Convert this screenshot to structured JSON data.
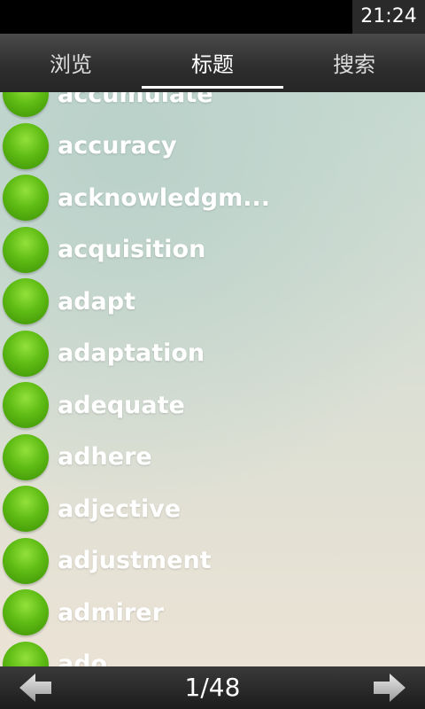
{
  "status": {
    "time": "21:24"
  },
  "tabs": [
    {
      "label": "浏览"
    },
    {
      "label": "标题"
    },
    {
      "label": "搜索"
    }
  ],
  "list": {
    "items": [
      {
        "label": "accumulate"
      },
      {
        "label": "accuracy"
      },
      {
        "label": "acknowledgm..."
      },
      {
        "label": "acquisition"
      },
      {
        "label": "adapt"
      },
      {
        "label": "adaptation"
      },
      {
        "label": "adequate"
      },
      {
        "label": "adhere"
      },
      {
        "label": "adjective"
      },
      {
        "label": "adjustment"
      },
      {
        "label": "admirer"
      },
      {
        "label": "ado"
      }
    ]
  },
  "pager": {
    "indicator": "1/48"
  },
  "colors": {
    "accent_green": "#5fbc14",
    "tab_bar": "#2d2d2d"
  }
}
